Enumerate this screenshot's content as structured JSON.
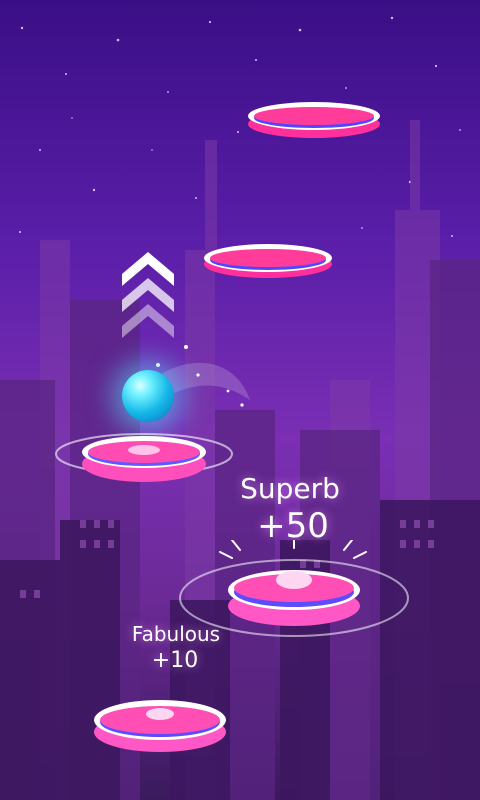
{
  "feedback": {
    "superb_label": "Superb",
    "superb_points": "+50",
    "fabulous_label": "Fabulous",
    "fabulous_points": "+10"
  },
  "colors": {
    "tile_top": "#ffffff",
    "tile_mid": "#ff2f9b",
    "tile_bottom": "#5146ff",
    "ball": "#1ec8ff",
    "sky_top": "#3a0f86",
    "sky_bottom": "#3a1a5c"
  },
  "icons": {
    "arrows": "triple-chevron-up-icon",
    "ball": "glowing-ball-icon"
  }
}
